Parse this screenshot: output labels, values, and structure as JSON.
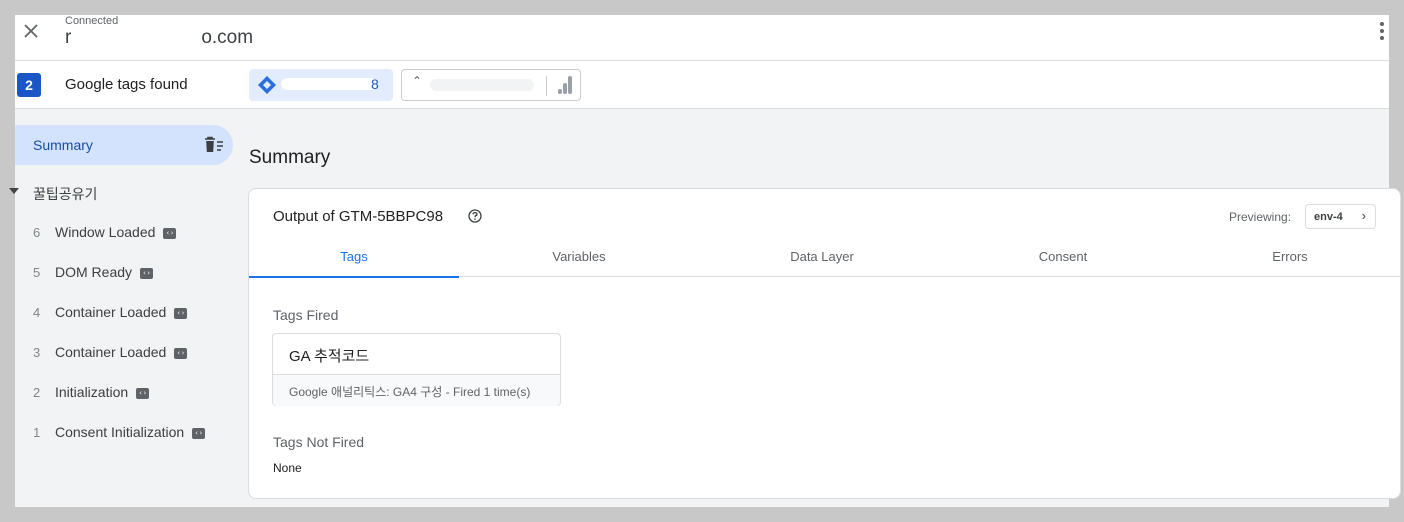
{
  "header": {
    "status": "Connected",
    "domain_prefix": "r",
    "domain_suffix": "o.com"
  },
  "tagsbar": {
    "count": "2",
    "label": "Google tags found",
    "tag1_suffix": "8"
  },
  "sidebar": {
    "summary_label": "Summary",
    "group_label": "꿀팁공유기",
    "events": [
      {
        "num": "6",
        "label": "Window Loaded"
      },
      {
        "num": "5",
        "label": "DOM Ready"
      },
      {
        "num": "4",
        "label": "Container Loaded"
      },
      {
        "num": "3",
        "label": "Container Loaded"
      },
      {
        "num": "2",
        "label": "Initialization"
      },
      {
        "num": "1",
        "label": "Consent Initialization"
      }
    ]
  },
  "main": {
    "title": "Summary",
    "card_title": "Output of GTM-5BBPC98",
    "previewing_label": "Previewing:",
    "env_label": "env-4",
    "tabs": [
      "Tags",
      "Variables",
      "Data Layer",
      "Consent",
      "Errors"
    ],
    "tags_fired_label": "Tags Fired",
    "fired_tag": {
      "name": "GA 추적코드",
      "detail": "Google 애널리틱스: GA4 구성 - Fired 1 time(s)"
    },
    "tags_not_fired_label": "Tags Not Fired",
    "not_fired_value": "None"
  },
  "colors": {
    "accent": "#1a73e8",
    "badge": "#1a56c5",
    "selected_bg": "#d3e3fd"
  }
}
